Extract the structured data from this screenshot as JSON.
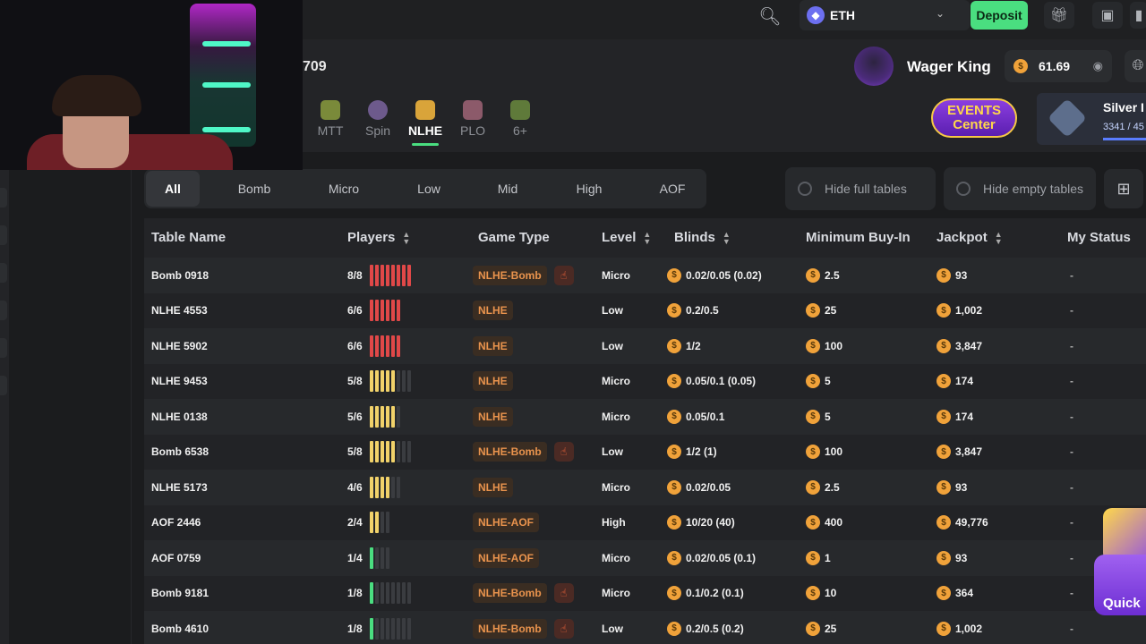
{
  "topbar": {
    "currency": "ETH",
    "deposit_label": "Deposit"
  },
  "header": {
    "room_number": "709",
    "game_tabs": [
      {
        "label": "MTT"
      },
      {
        "label": "Spin"
      },
      {
        "label": "NLHE"
      },
      {
        "label": "PLO"
      },
      {
        "label": "6+"
      }
    ],
    "username": "Wager King",
    "balance": "61.69",
    "events_line1": "EVENTS",
    "events_line2": "Center",
    "rank_name": "Silver I",
    "rank_xp": "3341 / 45",
    "rank_progress": 0.74
  },
  "filters": {
    "levels": [
      "All",
      "Bomb",
      "Micro",
      "Low",
      "Mid",
      "High",
      "AOF"
    ],
    "hide_full": "Hide full tables",
    "hide_empty": "Hide empty tables"
  },
  "table": {
    "headers": {
      "name": "Table Name",
      "players": "Players",
      "game_type": "Game Type",
      "level": "Level",
      "blinds": "Blinds",
      "min_buyin": "Minimum Buy-In",
      "jackpot": "Jackpot",
      "status": "My Status"
    },
    "rows": [
      {
        "name": "Bomb 0918",
        "players": "8/8",
        "seated": 8,
        "seats": 8,
        "color": "red",
        "type": "NLHE-Bomb",
        "bomb": true,
        "level": "Micro",
        "blinds": "0.02/0.05 (0.02)",
        "buyin": "2.5",
        "jackpot": "93",
        "status": "-"
      },
      {
        "name": "NLHE 4553",
        "players": "6/6",
        "seated": 6,
        "seats": 6,
        "color": "red",
        "type": "NLHE",
        "bomb": false,
        "level": "Low",
        "blinds": "0.2/0.5",
        "buyin": "25",
        "jackpot": "1,002",
        "status": "-"
      },
      {
        "name": "NLHE 5902",
        "players": "6/6",
        "seated": 6,
        "seats": 6,
        "color": "red",
        "type": "NLHE",
        "bomb": false,
        "level": "Low",
        "blinds": "1/2",
        "buyin": "100",
        "jackpot": "3,847",
        "status": "-"
      },
      {
        "name": "NLHE 9453",
        "players": "5/8",
        "seated": 5,
        "seats": 8,
        "color": "yellow",
        "type": "NLHE",
        "bomb": false,
        "level": "Micro",
        "blinds": "0.05/0.1 (0.05)",
        "buyin": "5",
        "jackpot": "174",
        "status": "-"
      },
      {
        "name": "NLHE 0138",
        "players": "5/6",
        "seated": 5,
        "seats": 6,
        "color": "yellow",
        "type": "NLHE",
        "bomb": false,
        "level": "Micro",
        "blinds": "0.05/0.1",
        "buyin": "5",
        "jackpot": "174",
        "status": "-"
      },
      {
        "name": "Bomb 6538",
        "players": "5/8",
        "seated": 5,
        "seats": 8,
        "color": "yellow",
        "type": "NLHE-Bomb",
        "bomb": true,
        "level": "Low",
        "blinds": "1/2 (1)",
        "buyin": "100",
        "jackpot": "3,847",
        "status": "-"
      },
      {
        "name": "NLHE 5173",
        "players": "4/6",
        "seated": 4,
        "seats": 6,
        "color": "yellow",
        "type": "NLHE",
        "bomb": false,
        "level": "Micro",
        "blinds": "0.02/0.05",
        "buyin": "2.5",
        "jackpot": "93",
        "status": "-"
      },
      {
        "name": "AOF 2446",
        "players": "2/4",
        "seated": 2,
        "seats": 4,
        "color": "yellow",
        "type": "NLHE-AOF",
        "bomb": false,
        "level": "High",
        "blinds": "10/20 (40)",
        "buyin": "400",
        "jackpot": "49,776",
        "status": "-"
      },
      {
        "name": "AOF 0759",
        "players": "1/4",
        "seated": 1,
        "seats": 4,
        "color": "green",
        "type": "NLHE-AOF",
        "bomb": false,
        "level": "Micro",
        "blinds": "0.02/0.05 (0.1)",
        "buyin": "1",
        "jackpot": "93",
        "status": "-"
      },
      {
        "name": "Bomb 9181",
        "players": "1/8",
        "seated": 1,
        "seats": 8,
        "color": "green",
        "type": "NLHE-Bomb",
        "bomb": true,
        "level": "Micro",
        "blinds": "0.1/0.2 (0.1)",
        "buyin": "10",
        "jackpot": "364",
        "status": "-"
      },
      {
        "name": "Bomb 4610",
        "players": "1/8",
        "seated": 1,
        "seats": 8,
        "color": "green",
        "type": "NLHE-Bomb",
        "bomb": true,
        "level": "Low",
        "blinds": "0.2/0.5 (0.2)",
        "buyin": "25",
        "jackpot": "1,002",
        "status": "-"
      }
    ]
  },
  "quick_label": "Quick",
  "colors": {
    "accent_green": "#4ade80",
    "full_red": "#e04848",
    "partial_yellow": "#f1d26a",
    "tag_orange": "#e9934d"
  }
}
